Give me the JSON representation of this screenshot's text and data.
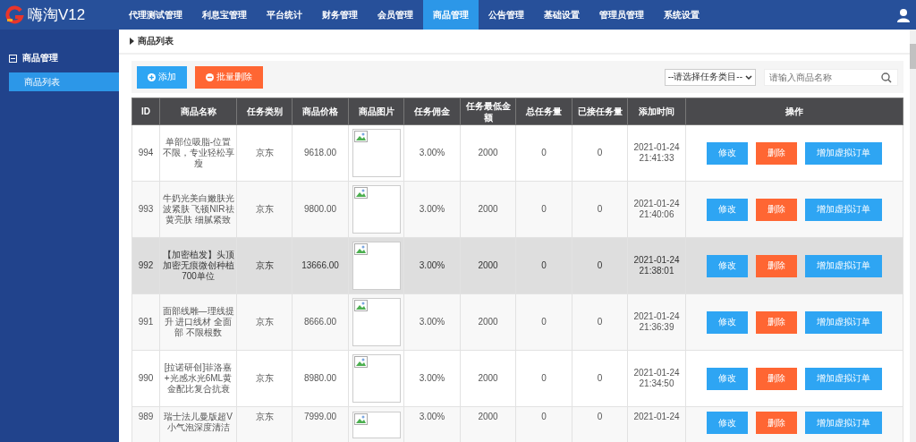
{
  "app": {
    "logo_text": "嗨淘V12"
  },
  "nav": [
    {
      "label": "代理测试管理",
      "selected": false
    },
    {
      "label": "利息宝管理",
      "selected": false
    },
    {
      "label": "平台统计",
      "selected": false
    },
    {
      "label": "财务管理",
      "selected": false
    },
    {
      "label": "会员管理",
      "selected": false
    },
    {
      "label": "商品管理",
      "selected": true
    },
    {
      "label": "公告管理",
      "selected": false
    },
    {
      "label": "基础设置",
      "selected": false
    },
    {
      "label": "管理员管理",
      "selected": false
    },
    {
      "label": "系统设置",
      "selected": false
    }
  ],
  "sidebar": {
    "group": {
      "label": "商品管理",
      "expanded": true,
      "items": [
        {
          "label": "商品列表",
          "selected": true
        }
      ]
    }
  },
  "breadcrumb": "商品列表",
  "toolbar": {
    "buttons": [
      {
        "label": "添加",
        "kind": "add"
      },
      {
        "label": "批量删除",
        "kind": "delete"
      }
    ],
    "category_select": {
      "value": "--请选择任务类目--"
    },
    "search": {
      "placeholder": "请输入商品名称"
    }
  },
  "table": {
    "columns": [
      "ID",
      "商品名称",
      "任务类别",
      "商品价格",
      "商品图片",
      "任务佣金",
      "任务最低金额",
      "总任务量",
      "已接任务量",
      "添加时间",
      "操作"
    ],
    "rows": [
      {
        "id": "994",
        "name": "单部位吸脂-位置不限，专业轻松享瘦",
        "category": "京东",
        "price": "9618.00",
        "commission": "3.00%",
        "min_amount": "2000",
        "total_tasks": "0",
        "accepted_tasks": "0",
        "added_date": "2021-01-24",
        "added_time": "21:41:33",
        "highlighted": false,
        "actions": [
          {
            "label": "修改",
            "kind": "edit"
          },
          {
            "label": "删除",
            "kind": "delete"
          },
          {
            "label": "增加虚拟订单",
            "kind": "edit"
          }
        ]
      },
      {
        "id": "993",
        "name": "牛奶光美白嫩肤光波紧肤 飞顿NIR祛黄亮肤 细腻紧致",
        "category": "京东",
        "price": "9800.00",
        "commission": "3.00%",
        "min_amount": "2000",
        "total_tasks": "0",
        "accepted_tasks": "0",
        "added_date": "2021-01-24",
        "added_time": "21:40:06",
        "highlighted": false,
        "actions": [
          {
            "label": "修改",
            "kind": "edit"
          },
          {
            "label": "删除",
            "kind": "delete"
          },
          {
            "label": "增加虚拟订单",
            "kind": "edit"
          }
        ]
      },
      {
        "id": "992",
        "name": "【加密植发】头顶加密无痕微创种植700单位",
        "category": "京东",
        "price": "13666.00",
        "commission": "3.00%",
        "min_amount": "2000",
        "total_tasks": "0",
        "accepted_tasks": "0",
        "added_date": "2021-01-24",
        "added_time": "21:38:01",
        "highlighted": true,
        "actions": [
          {
            "label": "修改",
            "kind": "edit"
          },
          {
            "label": "删除",
            "kind": "delete"
          },
          {
            "label": "增加虚拟订单",
            "kind": "edit"
          }
        ]
      },
      {
        "id": "991",
        "name": "面部线雕—理线提升 进口线材 全面部 不限根数",
        "category": "京东",
        "price": "8666.00",
        "commission": "3.00%",
        "min_amount": "2000",
        "total_tasks": "0",
        "accepted_tasks": "0",
        "added_date": "2021-01-24",
        "added_time": "21:36:39",
        "highlighted": false,
        "actions": [
          {
            "label": "修改",
            "kind": "edit"
          },
          {
            "label": "删除",
            "kind": "delete"
          },
          {
            "label": "增加虚拟订单",
            "kind": "edit"
          }
        ]
      },
      {
        "id": "990",
        "name": "[拉诺研创]菲洛嘉+光感水光6ML黄金配比复合抗衰",
        "category": "京东",
        "price": "8980.00",
        "commission": "3.00%",
        "min_amount": "2000",
        "total_tasks": "0",
        "accepted_tasks": "0",
        "added_date": "2021-01-24",
        "added_time": "21:34:50",
        "highlighted": false,
        "actions": [
          {
            "label": "修改",
            "kind": "edit"
          },
          {
            "label": "删除",
            "kind": "delete"
          },
          {
            "label": "增加虚拟订单",
            "kind": "edit"
          }
        ]
      },
      {
        "id": "989",
        "name": "瑞士法儿曼版超V小气泡深度清洁",
        "category": "京东",
        "price": "7999.00",
        "commission": "3.00%",
        "min_amount": "2000",
        "total_tasks": "0",
        "accepted_tasks": "0",
        "added_date": "2021-01-24",
        "highlighted": false,
        "actions": [
          {
            "label": "修改",
            "kind": "edit"
          },
          {
            "label": "删除",
            "kind": "delete"
          },
          {
            "label": "增加虚拟订单",
            "kind": "edit"
          }
        ]
      }
    ]
  }
}
